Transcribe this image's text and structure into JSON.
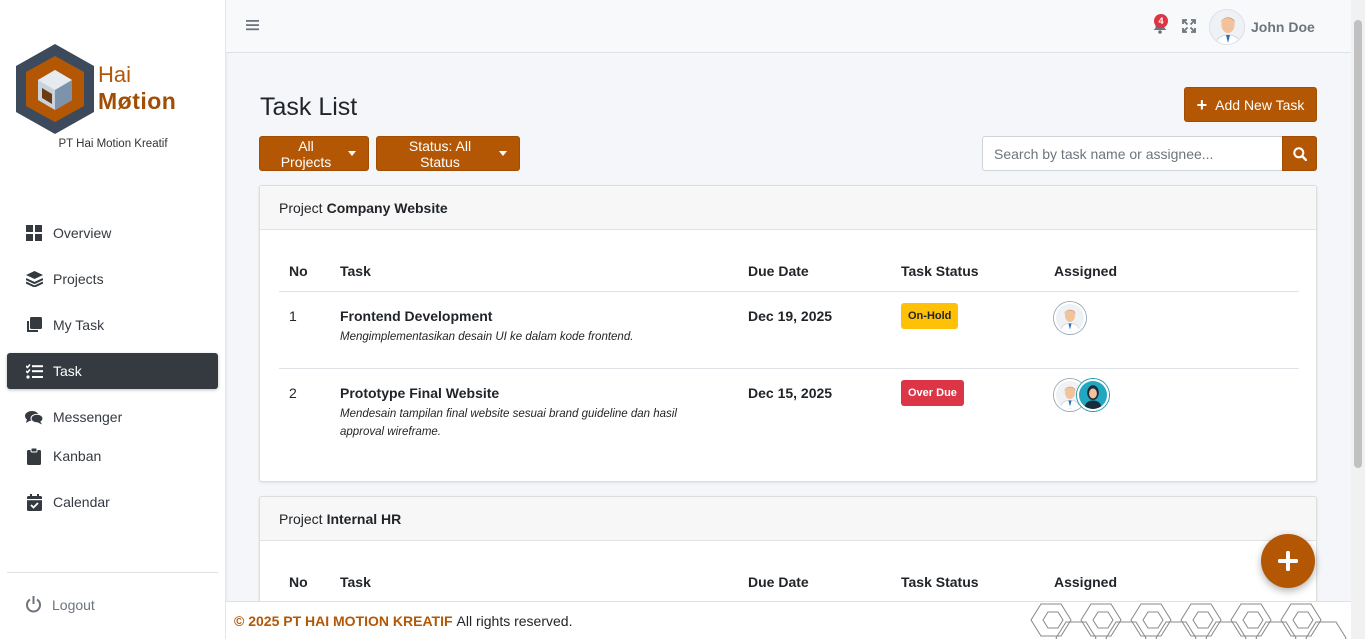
{
  "brand": {
    "line1": "Hai",
    "line2": "Møtion",
    "subtitle": "PT Hai Motion Kreatif"
  },
  "sidebar": {
    "items": [
      {
        "label": "Overview",
        "icon": "grid-icon"
      },
      {
        "label": "Projects",
        "icon": "layers-icon"
      },
      {
        "label": "My Task",
        "icon": "copy-icon"
      },
      {
        "label": "Task",
        "icon": "tasks-icon",
        "active": true
      },
      {
        "label": "Messenger",
        "icon": "comments-icon"
      },
      {
        "label": "Kanban",
        "icon": "clipboard-icon"
      },
      {
        "label": "Calendar",
        "icon": "calendar-check-icon"
      }
    ],
    "logout": "Logout"
  },
  "topbar": {
    "notification_count": "4",
    "user_name": "John Doe"
  },
  "page": {
    "title": "Task List",
    "add_button": "Add New Task",
    "filter_projects": "All Projects",
    "filter_status": "Status: All Status",
    "search_placeholder": "Search by task name or assignee..."
  },
  "table_headers": {
    "no": "No",
    "task": "Task",
    "due": "Due Date",
    "status": "Task Status",
    "assigned": "Assigned"
  },
  "projects": [
    {
      "prefix": "Project",
      "name": "Company Website",
      "tasks": [
        {
          "no": "1",
          "title": "Frontend Development",
          "desc": "Mengimplementasikan desain UI ke dalam kode frontend.",
          "due": "Dec 19, 2025",
          "status": "On-Hold"
        },
        {
          "no": "2",
          "title": "Prototype Final Website",
          "desc": "Mendesain tampilan final website sesuai brand guideline dan hasil approval wireframe.",
          "due": "Dec 15, 2025",
          "status": "Over Due"
        }
      ]
    },
    {
      "prefix": "Project",
      "name": "Internal HR",
      "tasks": []
    }
  ],
  "footer": {
    "copyright": "© 2025 PT HAI MOTION KREATIF",
    "rights": "All rights reserved."
  },
  "colors": {
    "brand": "#b35705",
    "sidebar_active": "#343a40",
    "on_hold": "#ffc107",
    "over_due": "#dc3545"
  }
}
